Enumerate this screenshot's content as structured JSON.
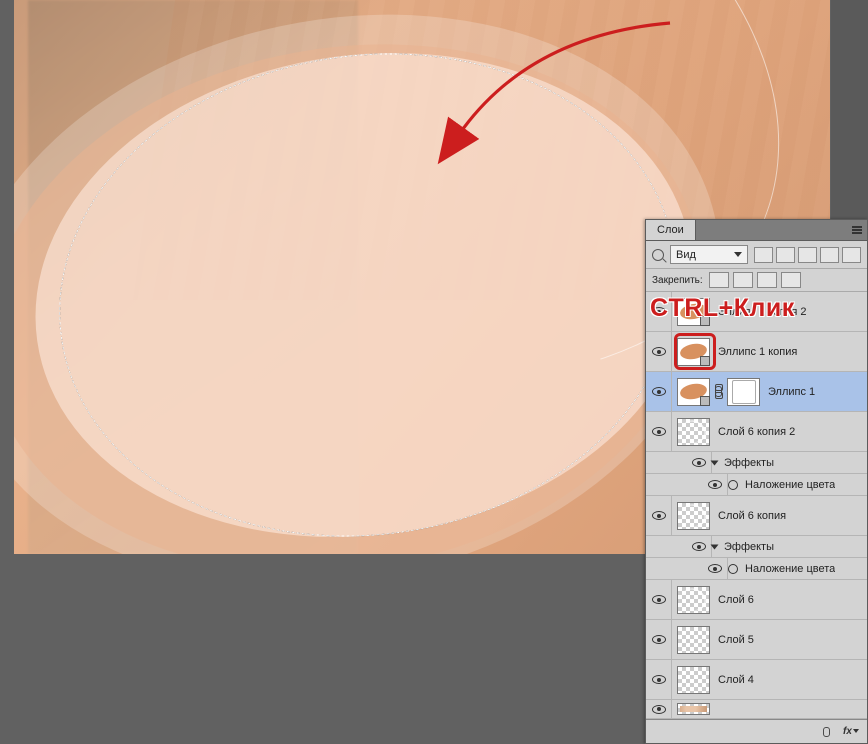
{
  "annotation": {
    "text": "CTRL+Клик"
  },
  "panel": {
    "tab": "Слои",
    "filter_label": "Вид",
    "lock_label": "Закрепить:",
    "effects_label": "Эффекты",
    "color_overlay_label": "Наложение цвета",
    "fx_label": "fx"
  },
  "layers": [
    {
      "name": "Эллипс 1 копия 2",
      "type": "ellipse"
    },
    {
      "name": "Эллипс 1 копия",
      "type": "ellipse",
      "highlight": true
    },
    {
      "name": "Эллипс 1",
      "type": "ellipse-masked",
      "selected": true
    },
    {
      "name": "Слой 6 копия 2",
      "type": "curve",
      "has_effects": true
    },
    {
      "name": "Слой 6 копия",
      "type": "curve",
      "has_effects": true
    },
    {
      "name": "Слой 6",
      "type": "curve"
    },
    {
      "name": "Слой 5",
      "type": "checker"
    },
    {
      "name": "Слой 4",
      "type": "checker"
    }
  ]
}
